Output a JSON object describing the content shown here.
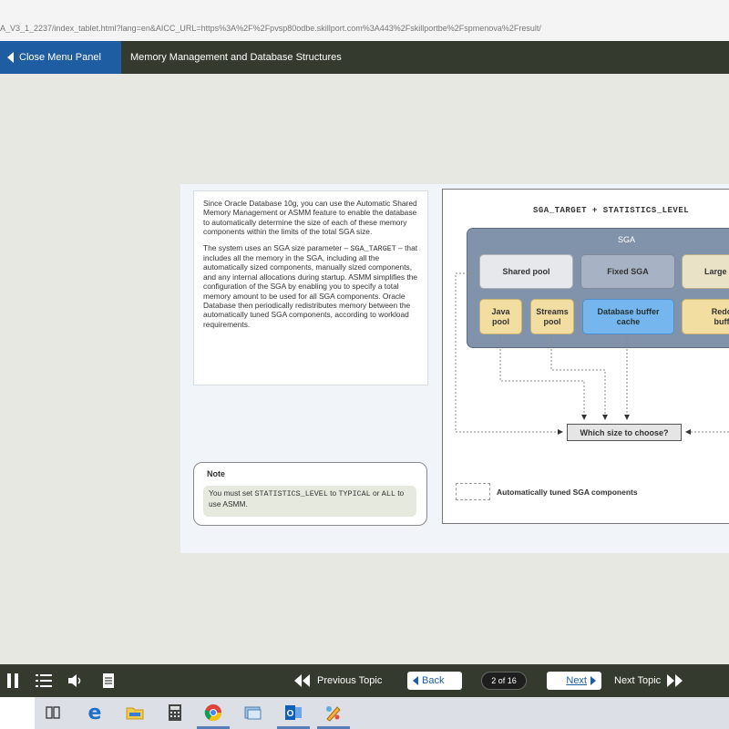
{
  "browser": {
    "url": "A_V3_1_2237/index_tablet.html?lang=en&AICC_URL=https%3A%2F%2Fpvsp80odbe.skillport.com%3A443%2Fskillportbe%2Fspmenova%2Fresult/"
  },
  "header": {
    "close_menu_label": "Close Menu Panel",
    "course_title": "Memory Management and Database Structures"
  },
  "text_panel": {
    "para1": "Since Oracle Database 10g, you can use the Automatic Shared Memory Management or ASMM feature to enable the database to automatically determine the size of each of these memory components within the limits of the total SGA size.",
    "para2_pre": "The system uses an SGA size parameter – ",
    "para2_code": "SGA_TARGET",
    "para2_post": " – that includes all the memory in the SGA, including all the automatically sized components, manually sized components, and any internal allocations during startup. ASMM simplifies the configuration of the SGA by enabling you to specify a total memory amount to be used for all SGA components. Oracle Database then periodically redistributes memory between the automatically tuned SGA components, according to workload requirements."
  },
  "note": {
    "title": "Note",
    "pre": "You must set ",
    "code1": "STATISTICS_LEVEL",
    "mid": " to ",
    "code2": "TYPICAL",
    "or": " or ",
    "code3": "ALL",
    "post": " to use ASMM."
  },
  "diagram": {
    "title": "SGA_TARGET + STATISTICS_LEVEL",
    "sga_label": "SGA",
    "components": {
      "shared_pool": "Shared pool",
      "fixed_sga": "Fixed SGA",
      "large_pool": "Large",
      "java_pool": "Java pool",
      "streams_pool": "Streams pool",
      "db_buffer_cache": "Database buffer cache",
      "redo_log_buffer": "Redo buff"
    },
    "choose_label": "Which size to choose?",
    "legend_label": "Automatically tuned SGA components",
    "colors": {
      "sga_block": "#8193ab",
      "auto_tuned_yellow": "#f3dea1",
      "buffer_cache_blue": "#76b6ee",
      "fixed_grey": "#a7b3c4"
    }
  },
  "player": {
    "previous_topic_label": "Previous Topic",
    "back_label": "Back",
    "page_indicator": "2 of 16",
    "next_label": "Next",
    "next_topic_label": "Next Topic"
  },
  "taskbar": {
    "icons": [
      "task-view-icon",
      "edge-icon",
      "file-explorer-icon",
      "calculator-icon",
      "chrome-icon",
      "app-icon",
      "outlook-icon",
      "paint-icon"
    ]
  }
}
